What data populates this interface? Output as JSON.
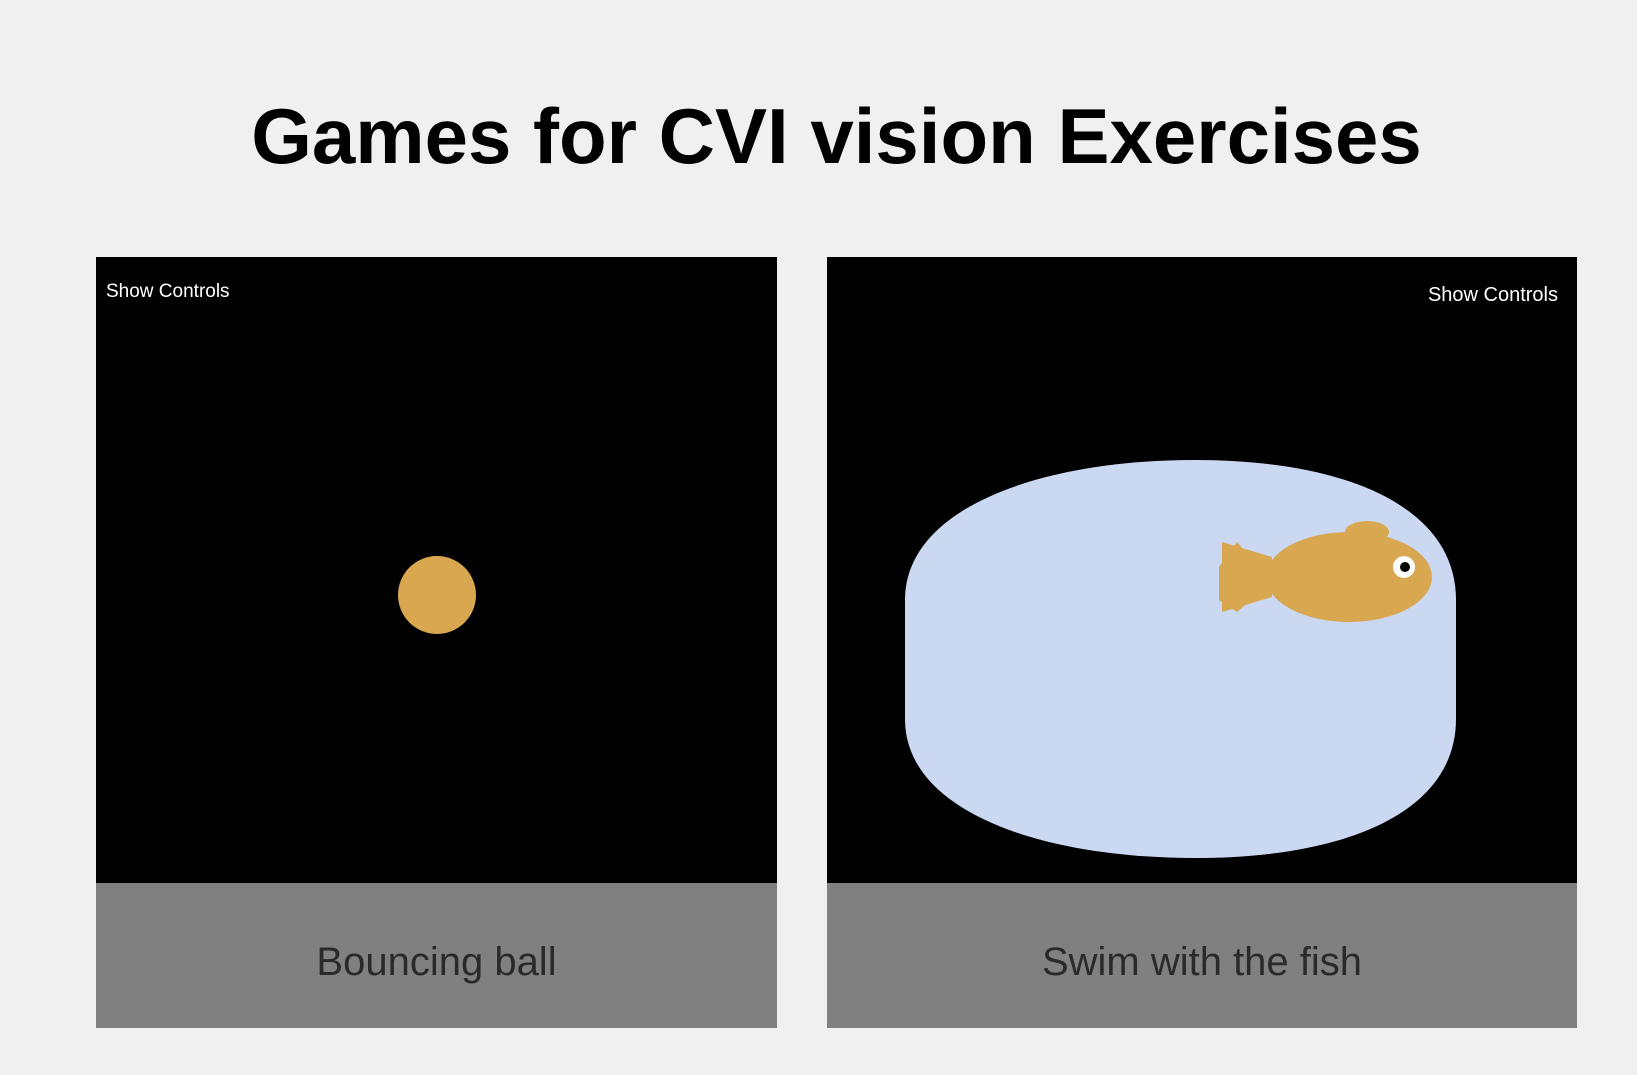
{
  "page": {
    "title": "Games for CVI vision Exercises"
  },
  "games": [
    {
      "name": "Bouncing ball",
      "controls_label": "Show Controls"
    },
    {
      "name": "Swim with the fish",
      "controls_label": "Show Controls"
    }
  ],
  "colors": {
    "background": "#f0f0f0",
    "preview_background": "#000000",
    "caption_background": "#808080",
    "caption_text": "#2a2a2a",
    "ball": "#d9a74f",
    "fish": "#d9a74f",
    "water": "#cad8f1"
  }
}
